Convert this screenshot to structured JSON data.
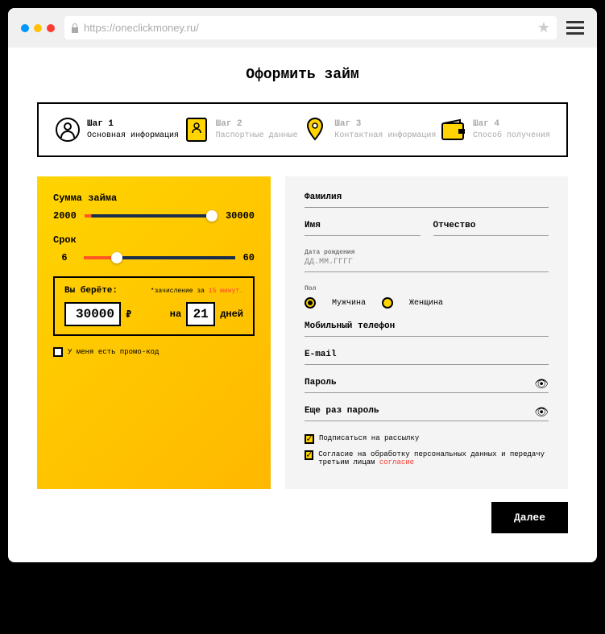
{
  "url": "https://oneclickmoney.ru/",
  "title": "Оформить займ",
  "steps": [
    {
      "title": "Шаг 1",
      "desc": "Основная информация"
    },
    {
      "title": "Шаг 2",
      "desc": "Паспортные данные"
    },
    {
      "title": "Шаг 3",
      "desc": "Контактная информация"
    },
    {
      "title": "Шаг 4",
      "desc": "Способ получения"
    }
  ],
  "loan": {
    "amount_label": "Сумма займа",
    "amount_min": "2000",
    "amount_max": "30000",
    "term_label": "Срок",
    "term_min": "6",
    "term_max": "60",
    "take_label": "Вы берёте:",
    "note_prefix": "*зачисление за ",
    "note_value": "15 минут.",
    "amount_value": "30000",
    "currency": "₽",
    "on_label": "на",
    "term_value": "21",
    "days_label": "дней",
    "promo_label": "У меня есть промо-код"
  },
  "form": {
    "surname": "Фамилия",
    "name": "Имя",
    "patronymic": "Отчество",
    "dob_label": "Дата рождения",
    "dob_placeholder": "ДД.ММ.ГГГГ",
    "gender_label": "Пол",
    "gender_male": "Мужчина",
    "gender_female": "Женщина",
    "phone": "Мобильный телефон",
    "email": "E-mail",
    "password": "Пароль",
    "password2": "Еще раз пароль",
    "subscribe": "Подписаться на рассылку",
    "consent_text": "Согласие на обработку персональных данных и передачу третьим лицам ",
    "consent_link": "согласие"
  },
  "next_btn": "Далее"
}
